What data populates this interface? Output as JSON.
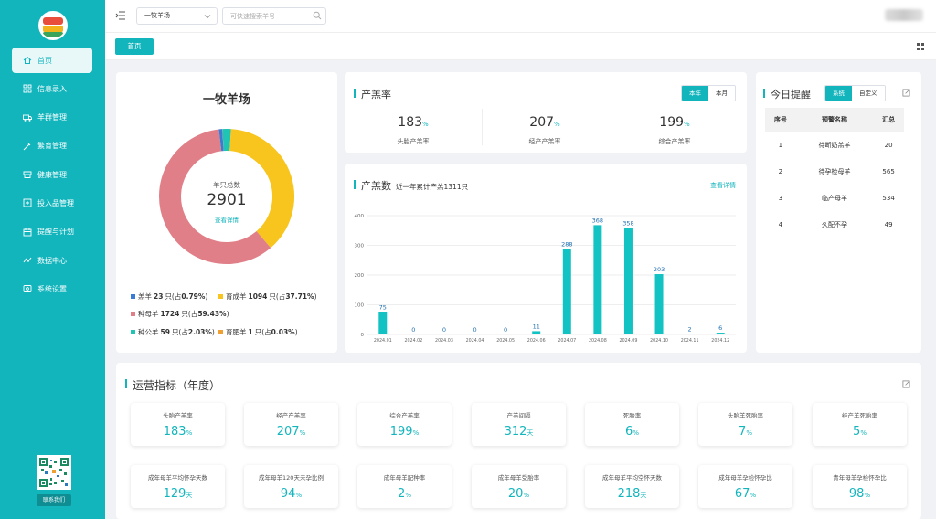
{
  "sidebar": {
    "items": [
      {
        "label": "首页",
        "icon": "home-icon"
      },
      {
        "label": "信息录入",
        "icon": "grid-icon"
      },
      {
        "label": "羊群管理",
        "icon": "truck-icon"
      },
      {
        "label": "繁育管理",
        "icon": "syringe-icon"
      },
      {
        "label": "健康管理",
        "icon": "shield-icon"
      },
      {
        "label": "投入品管理",
        "icon": "box-icon"
      },
      {
        "label": "提醒与计划",
        "icon": "calendar-icon"
      },
      {
        "label": "数据中心",
        "icon": "chart-icon"
      },
      {
        "label": "系统设置",
        "icon": "settings-icon"
      }
    ],
    "contact_label": "联系我们"
  },
  "topbar": {
    "farm_select": "一牧羊场",
    "search_placeholder": "可快速搜索羊号"
  },
  "tabbar": {
    "home_tab": "首页"
  },
  "summary": {
    "farm_name": "一牧羊场",
    "total_label": "羊只总数",
    "total": "2901",
    "detail_link": "查看详情",
    "legend": [
      {
        "name": "羔羊",
        "count": "23",
        "pct": "0.79%",
        "color": "#3a7bd5"
      },
      {
        "name": "育成羊",
        "count": "1094",
        "pct": "37.71%",
        "color": "#f7c51e"
      },
      {
        "name": "种母羊",
        "count": "1724",
        "pct": "59.43%",
        "color": "#e07f87"
      },
      {
        "name": "种公羊",
        "count": "59",
        "pct": "2.03%",
        "color": "#1fc4b4"
      },
      {
        "name": "育肥羊",
        "count": "1",
        "pct": "0.03%",
        "color": "#f0a030"
      }
    ],
    "unit_label": "只(占",
    "close_paren": ")"
  },
  "lambing_rate": {
    "title": "产羔率",
    "btn_year": "本年",
    "btn_month": "本月",
    "stats": [
      {
        "value": "183",
        "unit": "%",
        "label": "头胎产羔率"
      },
      {
        "value": "207",
        "unit": "%",
        "label": "经产产羔率"
      },
      {
        "value": "199",
        "unit": "%",
        "label": "综合产羔率"
      }
    ]
  },
  "lambing_count": {
    "title": "产羔数",
    "subtitle": "近一年累计产羔1311只",
    "link": "查看详情"
  },
  "chart_data": {
    "type": "bar",
    "categories": [
      "2024.01",
      "2024.02",
      "2024.03",
      "2024.04",
      "2024.05",
      "2024.06",
      "2024.07",
      "2024.08",
      "2024.09",
      "2024.10",
      "2024.11",
      "2024.12"
    ],
    "values": [
      75,
      0,
      0,
      0,
      0,
      11,
      288,
      368,
      358,
      203,
      2,
      6
    ],
    "yticks": [
      0,
      100,
      200,
      300,
      400
    ],
    "ylim": [
      0,
      400
    ],
    "color": "#13c2c2",
    "grid": true
  },
  "reminders": {
    "title": "今日提醒",
    "btn_system": "系统",
    "btn_custom": "自定义",
    "columns": [
      "序号",
      "预警名称",
      "汇总"
    ],
    "rows": [
      {
        "no": "1",
        "name": "待断奶羔羊",
        "count": "20"
      },
      {
        "no": "2",
        "name": "待孕检母羊",
        "count": "565"
      },
      {
        "no": "3",
        "name": "临产母羊",
        "count": "534"
      },
      {
        "no": "4",
        "name": "久配不孕",
        "count": "49"
      }
    ]
  },
  "ops": {
    "title": "运营指标（年度）",
    "items": [
      {
        "label": "头胎产羔率",
        "value": "183",
        "unit": "%"
      },
      {
        "label": "经产产羔率",
        "value": "207",
        "unit": "%"
      },
      {
        "label": "综合产羔率",
        "value": "199",
        "unit": "%"
      },
      {
        "label": "产羔间隔",
        "value": "312",
        "unit": "天"
      },
      {
        "label": "死胎率",
        "value": "6",
        "unit": "%"
      },
      {
        "label": "头胎羊死胎率",
        "value": "7",
        "unit": "%"
      },
      {
        "label": "经产羊死胎率",
        "value": "5",
        "unit": "%"
      },
      {
        "label": "成年母羊平均怀孕天数",
        "value": "129",
        "unit": "天"
      },
      {
        "label": "成年母羊120天未孕比例",
        "value": "94",
        "unit": "%"
      },
      {
        "label": "成年母羊配种率",
        "value": "2",
        "unit": "%"
      },
      {
        "label": "成年母羊受胎率",
        "value": "20",
        "unit": "%"
      },
      {
        "label": "成年母羊平均空怀天数",
        "value": "218",
        "unit": "天"
      },
      {
        "label": "成年母羊孕检怀孕比",
        "value": "67",
        "unit": "%"
      },
      {
        "label": "青年母羊孕检怀孕比",
        "value": "98",
        "unit": "%"
      }
    ]
  }
}
